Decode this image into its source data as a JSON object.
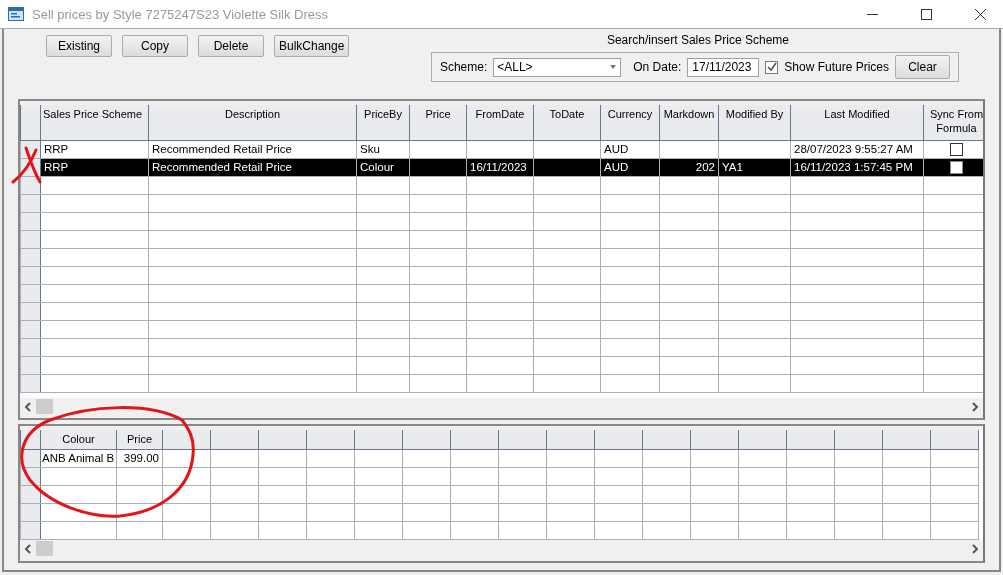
{
  "window": {
    "title": "Sell prices by Style 7275247S23 Violette Silk Dress"
  },
  "toolbar": {
    "buttons": [
      {
        "label": "Existing"
      },
      {
        "label": "Copy"
      },
      {
        "label": "Delete"
      },
      {
        "label": "BulkChange"
      }
    ],
    "search": {
      "label": "Search/insert Sales Price Scheme"
    }
  },
  "filter": {
    "scheme_label": "Scheme:",
    "scheme_value": "<ALL>",
    "date_label": "On Date:",
    "date_value": "17/11/2023",
    "show_future": {
      "label": "Show Future Prices",
      "checked": true
    },
    "clear_button": "Clear"
  },
  "prices_table": {
    "columns": [
      "Sales Price Scheme",
      "Description",
      "PriceBy",
      "Price",
      "FromDate",
      "ToDate",
      "Currency",
      "Markdown",
      "Modified By",
      "Last Modified",
      "Sync From Formula"
    ],
    "rows": [
      {
        "selected": false,
        "cells": [
          "RRP",
          "Recommended Retail Price",
          "Sku",
          "",
          "",
          "",
          "AUD",
          "",
          "",
          "28/07/2023 9:55:27 AM"
        ],
        "sync": false
      },
      {
        "selected": true,
        "cells": [
          "RRP",
          "Recommended Retail Price",
          "Colour",
          "",
          "16/11/2023",
          "",
          "AUD",
          "202",
          "YA1",
          "16/11/2023 1:57:45 PM"
        ],
        "sync": false
      }
    ]
  },
  "detail_table": {
    "columns": [
      "Colour",
      "Price"
    ],
    "rows": [
      {
        "cells": [
          "ANB Animal B",
          "399.00"
        ]
      }
    ]
  }
}
